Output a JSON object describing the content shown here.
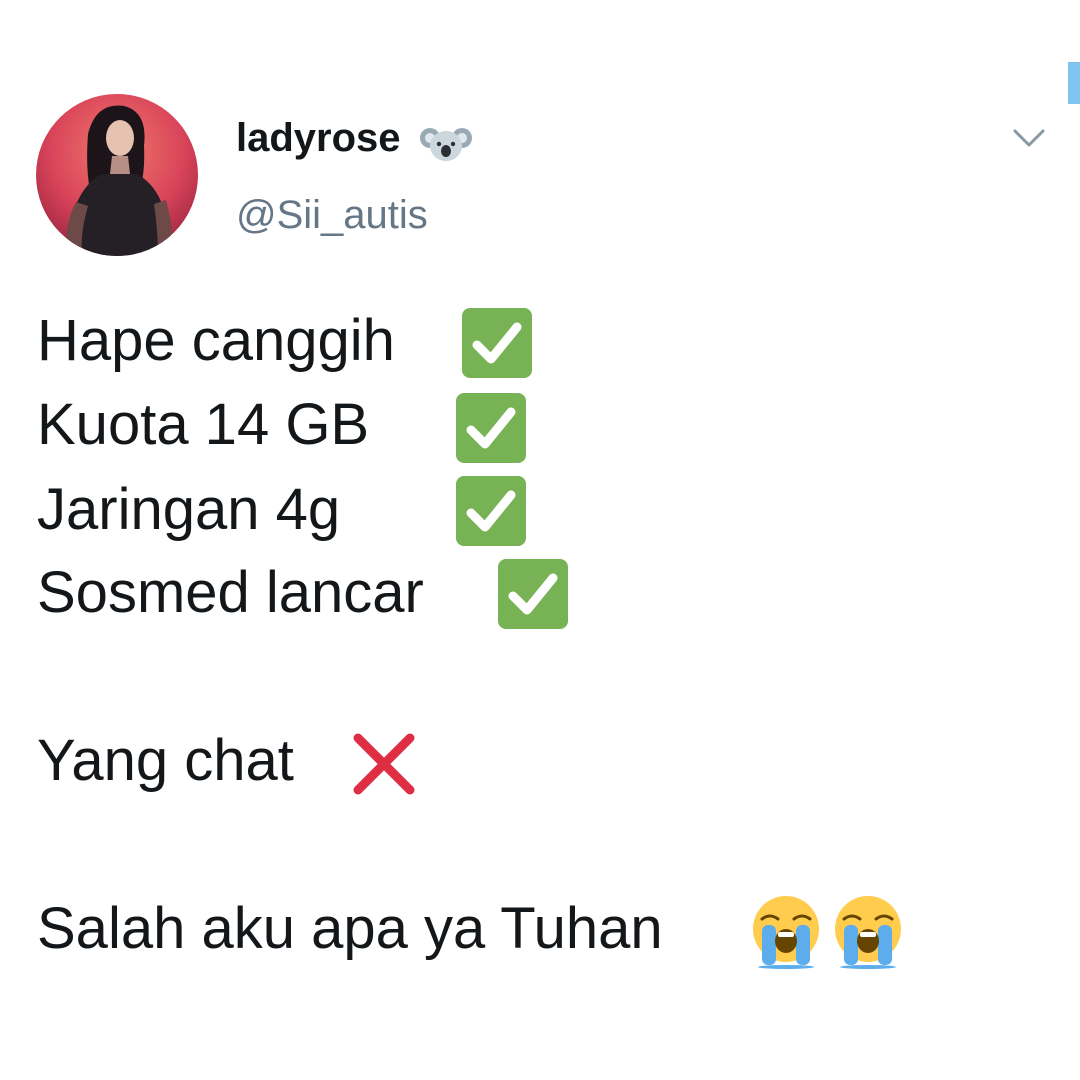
{
  "tweet": {
    "display_name": "ladyrose",
    "handle": "@Sii_autis",
    "badge_icon": "koala-icon",
    "menu_icon": "chevron-down-icon",
    "lines": [
      "Hape canggih",
      "Kuota 14 GB",
      "Jaringan 4g",
      "Sosmed lancar",
      "Yang chat",
      "Salah aku apa ya Tuhan"
    ],
    "line_icons": [
      "check-mark-button-icon",
      "check-mark-button-icon",
      "check-mark-button-icon",
      "check-mark-button-icon",
      "cross-mark-icon",
      "loudly-crying-face-icon"
    ]
  },
  "colors": {
    "text": "#14171a",
    "handle": "#657786",
    "check_green": "#77b255",
    "cross_red": "#dd2e44",
    "scroll_accent": "#7fc4ef"
  }
}
